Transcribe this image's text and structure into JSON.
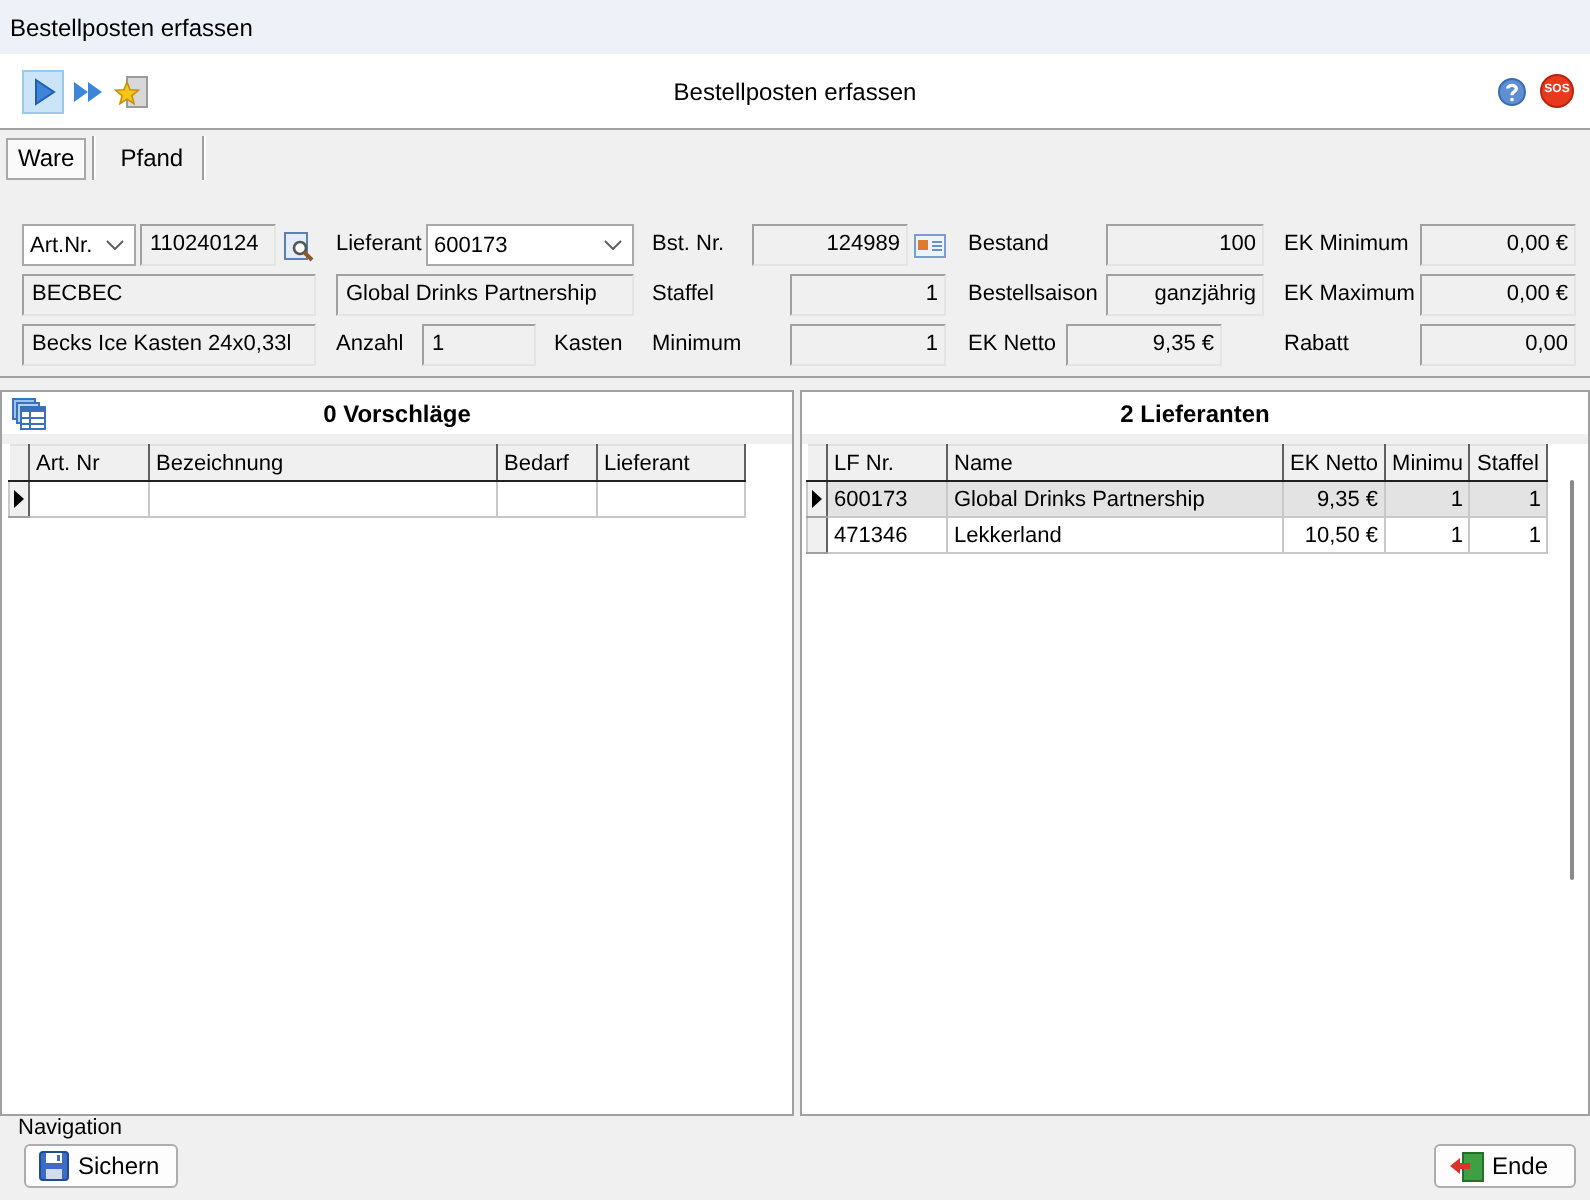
{
  "window": {
    "title": "Bestellposten erfassen"
  },
  "toolbar": {
    "buttons": [
      {
        "kind": "play",
        "selected": true
      },
      {
        "kind": "fast-forward",
        "selected": false
      },
      {
        "kind": "favorite",
        "selected": false
      }
    ],
    "title": "Bestellposten erfassen",
    "help_buttons": [
      {
        "kind": "help"
      },
      {
        "kind": "sos",
        "label": "SOS"
      }
    ]
  },
  "tabs": [
    {
      "label": "Ware",
      "selected": true
    },
    {
      "label": "Pfand",
      "selected": false
    }
  ],
  "article": {
    "search_by": "Art.Nr.",
    "number": "110240124",
    "code": "BECBEC",
    "description": "Becks Ice Kasten 24x0,33l"
  },
  "supplier": {
    "label": "Lieferant",
    "number": "600173",
    "name": "Global Drinks Partnership"
  },
  "quantity": {
    "label": "Anzahl",
    "value": "1",
    "unit": "Kasten"
  },
  "details": [
    {
      "label": "Bst. Nr.",
      "value": "124989"
    },
    {
      "label": "Bestand",
      "value": "100"
    },
    {
      "label": "EK Minimum",
      "value": "0,00 €"
    },
    {
      "label": "Staffel",
      "value": "1"
    },
    {
      "label": "Bestellsaison",
      "value": "ganzjährig"
    },
    {
      "label": "EK Maximum",
      "value": "0,00 €"
    },
    {
      "label": "Minimum",
      "value": "1"
    },
    {
      "label": "EK Netto",
      "value": "9,35 €"
    },
    {
      "label": "Rabatt",
      "value": "0,00"
    }
  ],
  "suggestions": {
    "title": "0 Vorschläge",
    "columns": [
      "Art. Nr",
      "Bezeichnung",
      "Bedarf",
      "Lieferant"
    ]
  },
  "suppliers": {
    "title": "2 Lieferanten",
    "columns": [
      "LF Nr.",
      "Name",
      "EK Netto",
      "Minimu",
      "Staffel"
    ],
    "rows": [
      {
        "cells": [
          "600173",
          "Global Drinks Partnership",
          "9,35 €",
          "1",
          "1"
        ],
        "selected": true
      },
      {
        "cells": [
          "471346",
          "Lekkerland",
          "10,50 €",
          "1",
          "1"
        ],
        "selected": false
      }
    ]
  },
  "footer": {
    "group_label": "Navigation",
    "buttons": [
      {
        "kind": "save",
        "label": "Sichern"
      },
      {
        "kind": "exit",
        "label": "Ende"
      }
    ]
  }
}
